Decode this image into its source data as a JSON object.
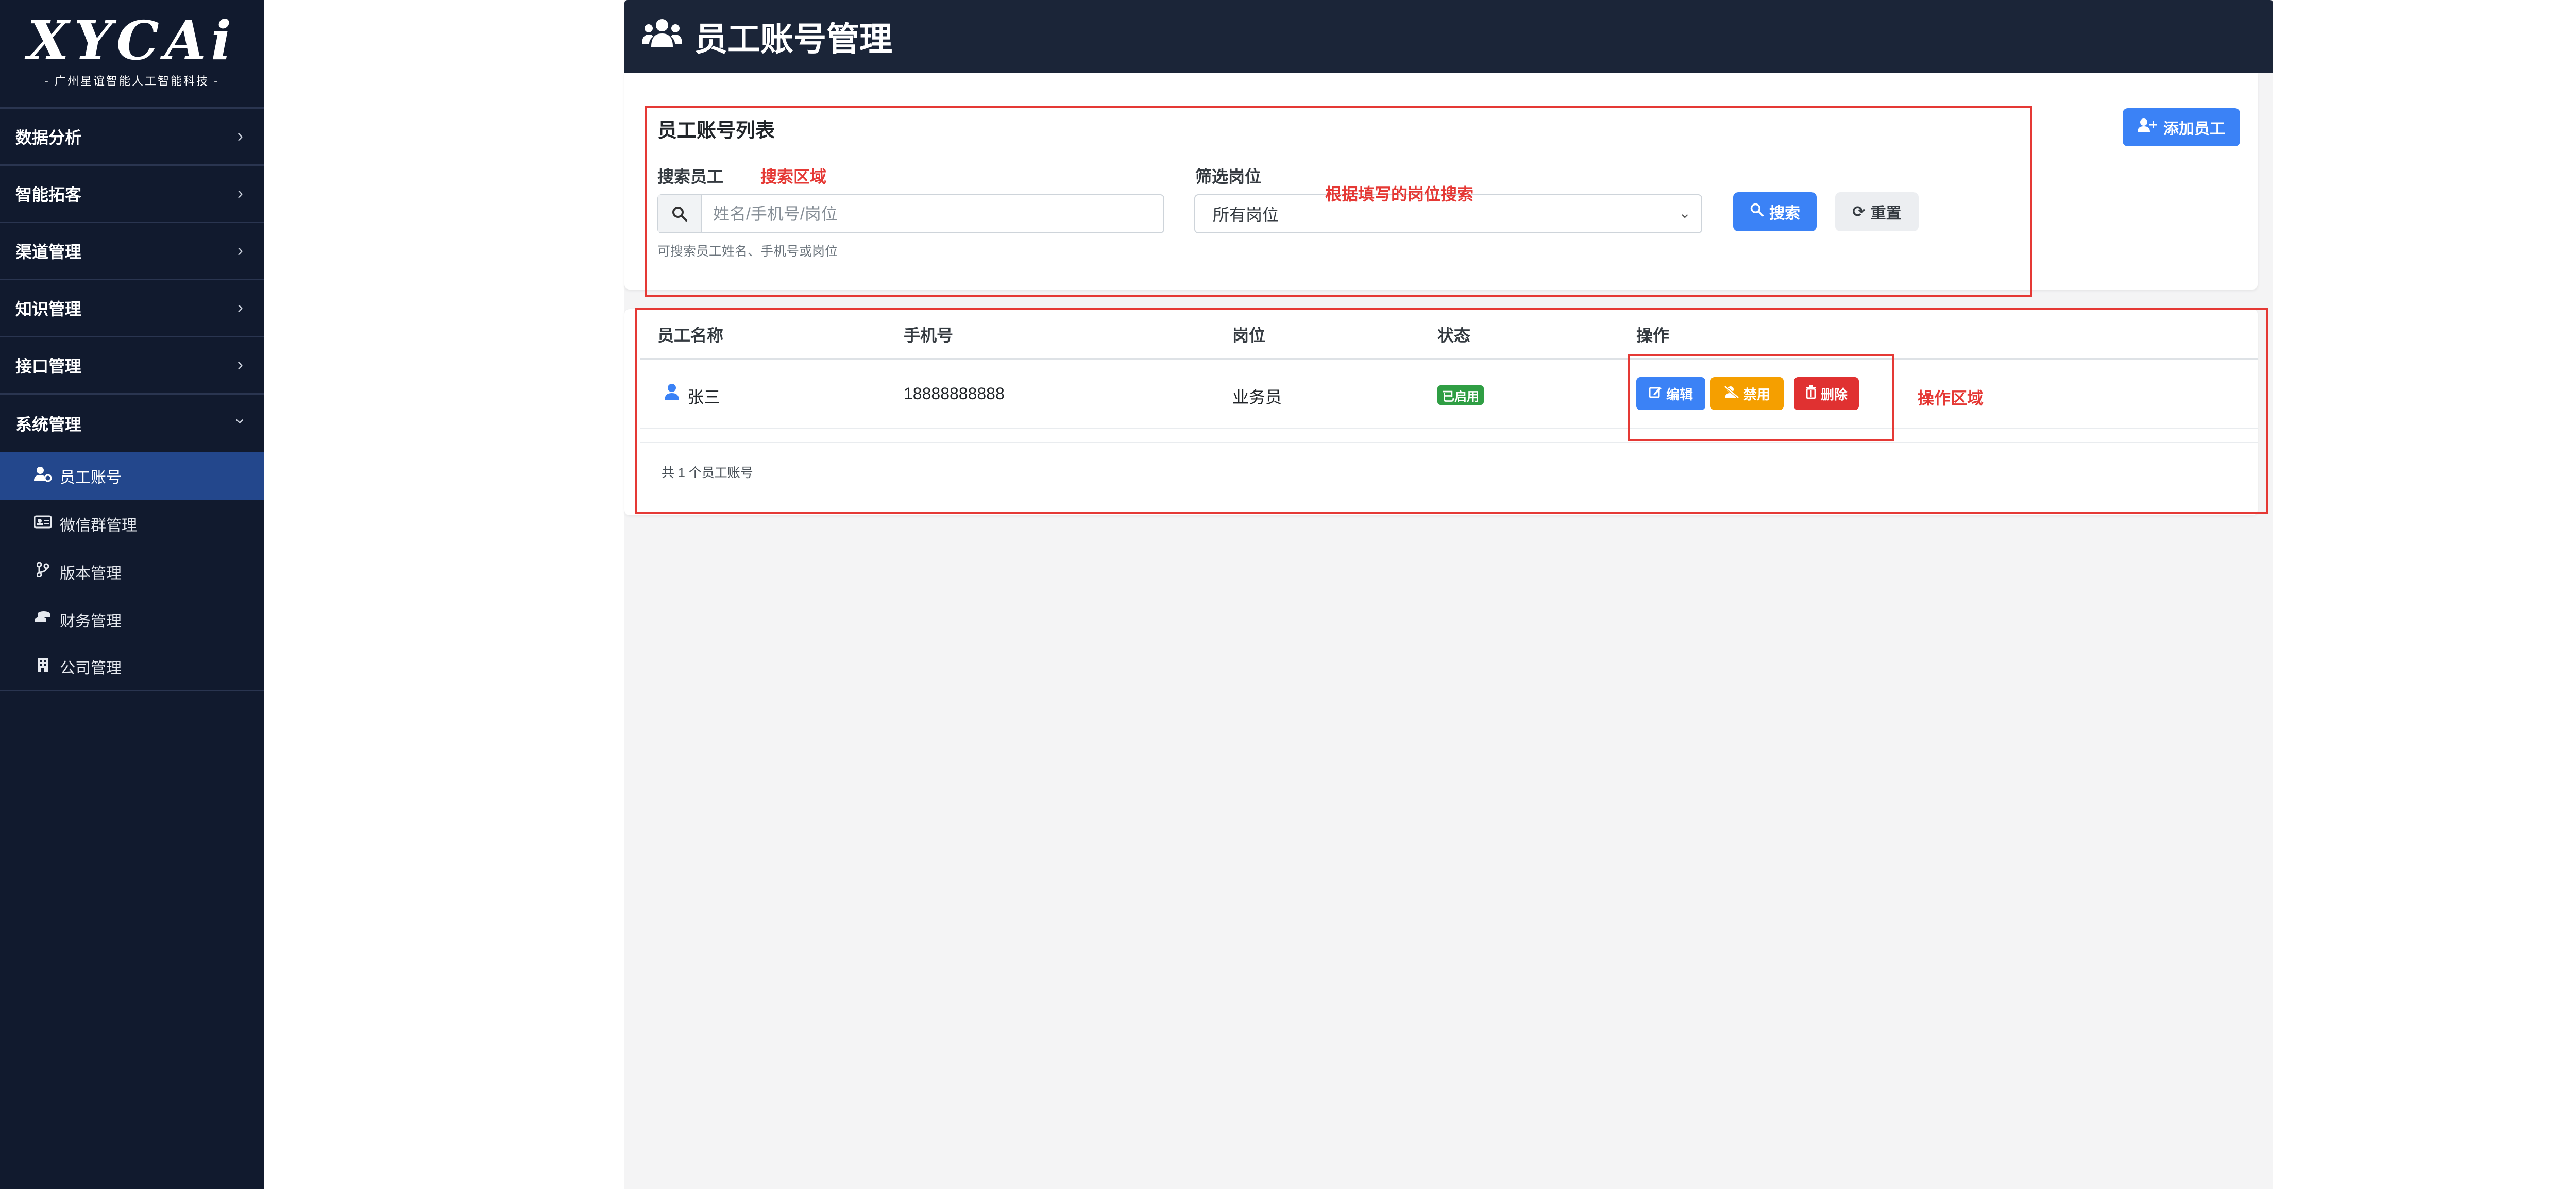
{
  "sidebar": {
    "logo": {
      "main": "XYCAi",
      "sub": "- 广州星谊智能人工智能科技 -"
    },
    "groups": [
      {
        "label": "数据分析",
        "icon": "chevron-right-icon"
      },
      {
        "label": "智能拓客",
        "icon": "chevron-right-icon"
      },
      {
        "label": "渠道管理",
        "icon": "chevron-right-icon"
      },
      {
        "label": "知识管理",
        "icon": "chevron-right-icon"
      },
      {
        "label": "接口管理",
        "icon": "chevron-right-icon"
      },
      {
        "label": "系统管理",
        "icon": "chevron-down-icon"
      }
    ],
    "items": [
      {
        "label": "员工账号",
        "icon": "user-gear-icon",
        "active": true
      },
      {
        "label": "微信群管理",
        "icon": "id-card-icon"
      },
      {
        "label": "版本管理",
        "icon": "code-branch-icon"
      },
      {
        "label": "财务管理",
        "icon": "coins-icon"
      },
      {
        "label": "公司管理",
        "icon": "building-icon"
      }
    ]
  },
  "header": {
    "title": "员工账号管理",
    "icon": "users-icon"
  },
  "search_panel": {
    "title": "员工账号列表",
    "add_button": "添加员工",
    "search_label": "搜索员工",
    "search_placeholder": "姓名/手机号/岗位",
    "search_hint": "可搜索员工姓名、手机号或岗位",
    "filter_label": "筛选岗位",
    "filter_selected": "所有岗位",
    "search_button": "搜索",
    "reset_button": "重置"
  },
  "annotations": {
    "search_area": "搜索区域",
    "position_search": "根据填写的岗位搜索",
    "action_area": "操作区域"
  },
  "table": {
    "columns": [
      "员工名称",
      "手机号",
      "岗位",
      "状态",
      "操作"
    ],
    "rows": [
      {
        "name": "张三",
        "phone": "18888888888",
        "position": "业务员",
        "status": "已启用",
        "actions": {
          "edit": "编辑",
          "disable": "禁用",
          "delete": "删除"
        }
      }
    ],
    "footer": "共 1 个员工账号"
  },
  "colors": {
    "sidebar_bg": "#111a2e",
    "active_item": "#23478c",
    "primary": "#3b82f6",
    "warning": "#f59f00",
    "danger": "#e03131",
    "success": "#2f9e44",
    "annotation": "#e53935"
  }
}
